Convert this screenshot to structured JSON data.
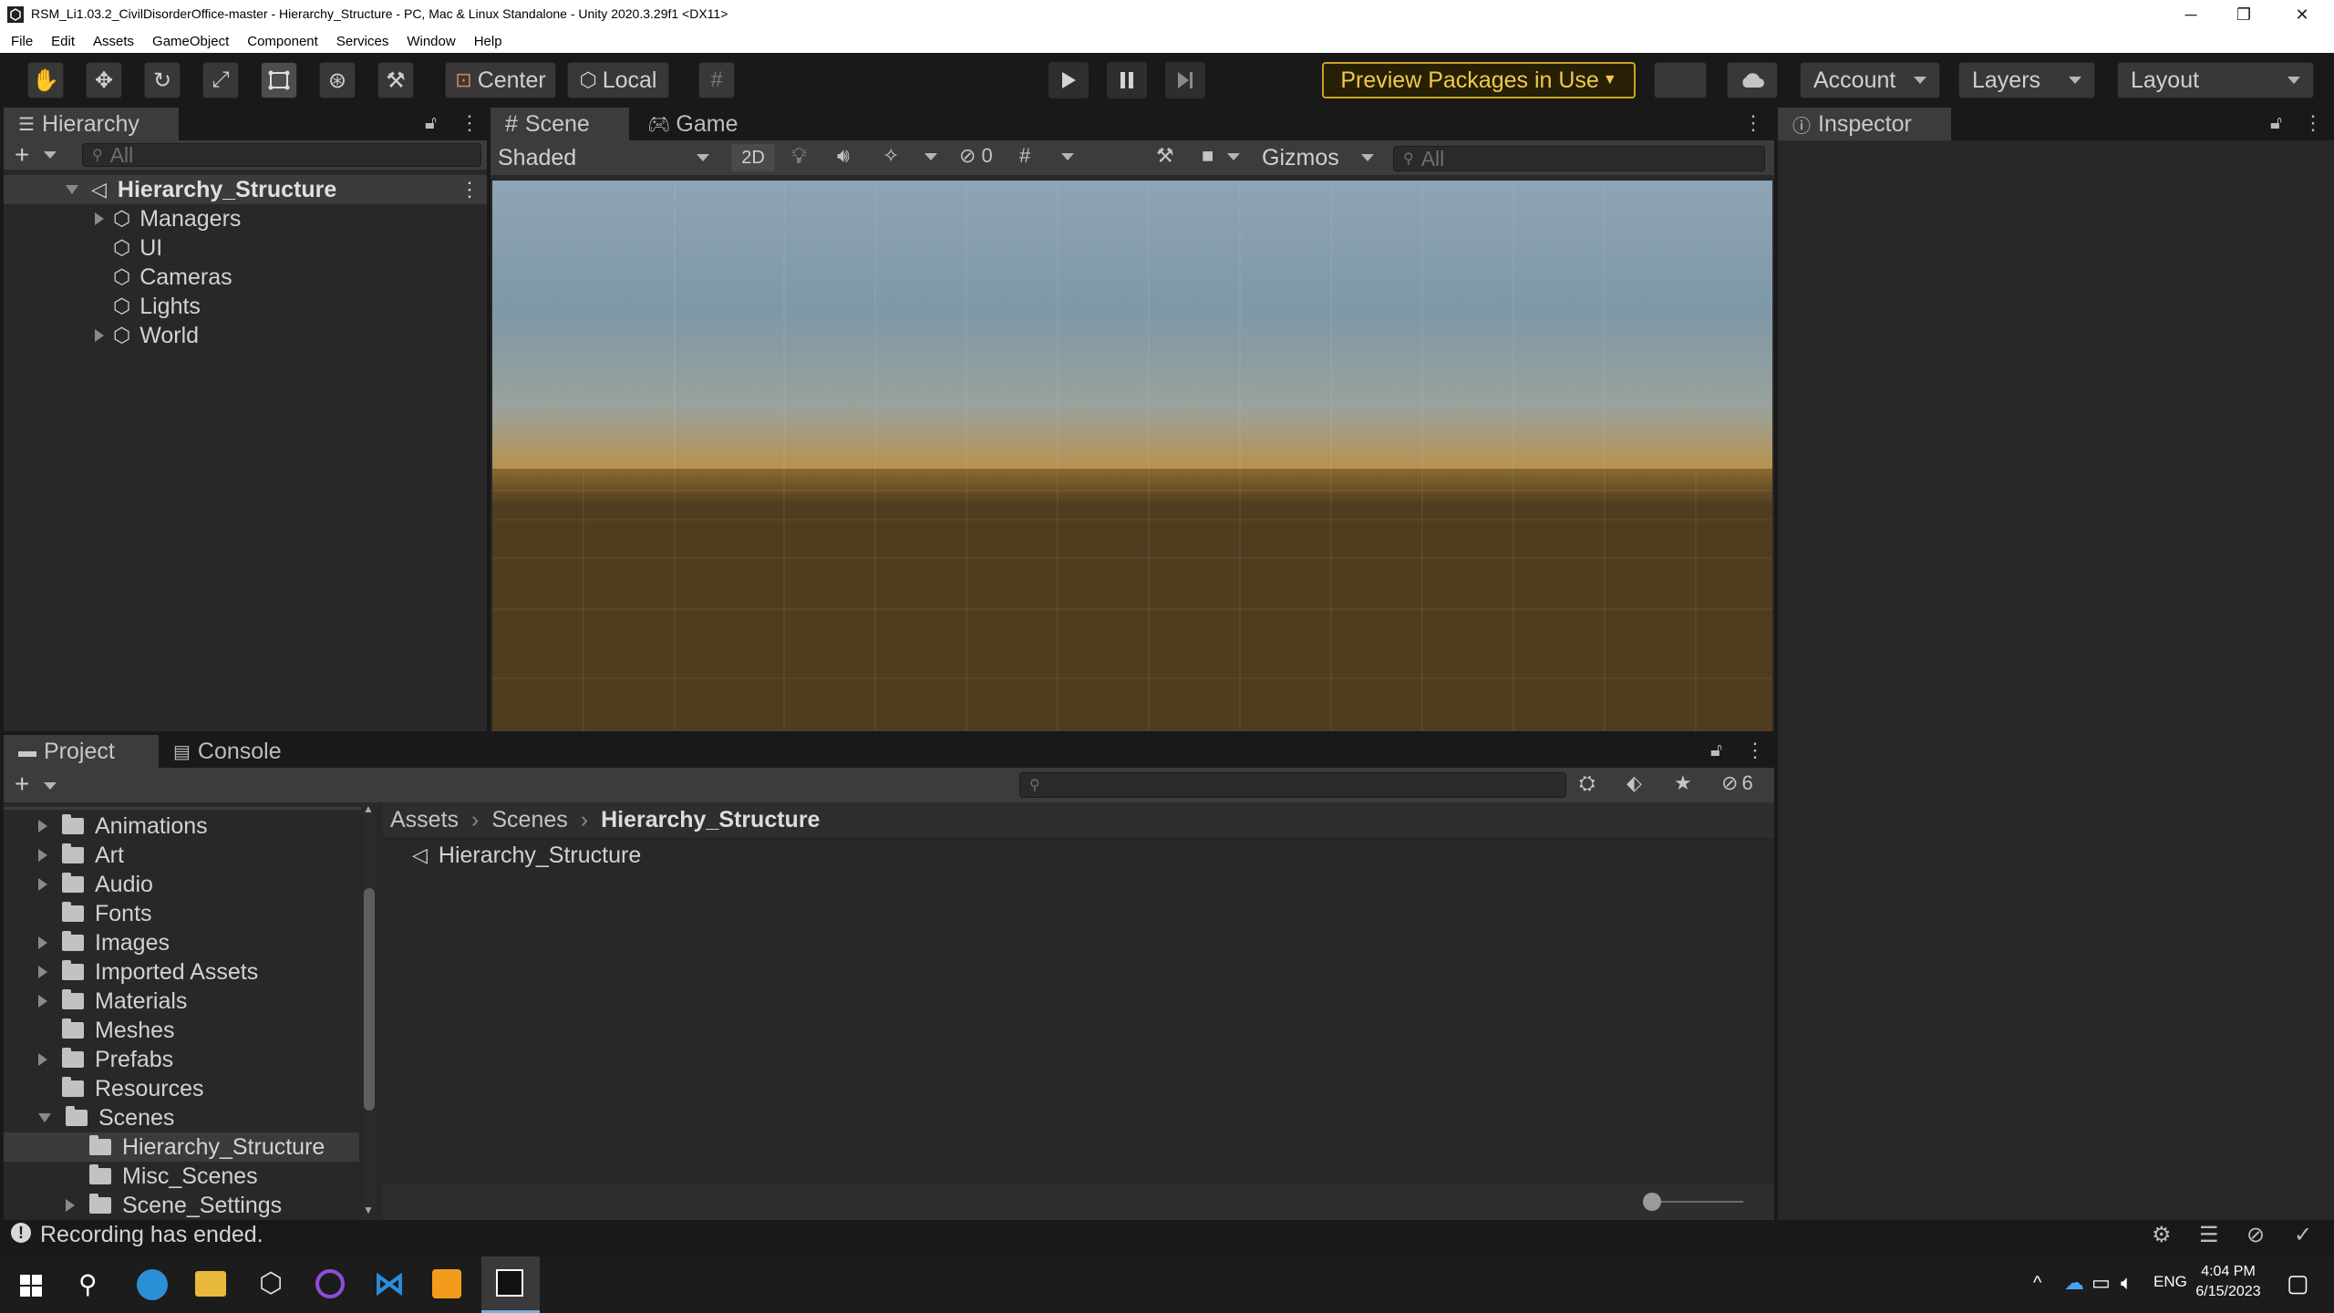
{
  "window": {
    "title": "RSM_Li1.03.2_CivilDisorderOffice-master - Hierarchy_Structure - PC, Mac & Linux Standalone - Unity 2020.3.29f1 <DX11>",
    "minimize": "─",
    "restore": "❐",
    "close": "✕"
  },
  "menu": [
    "File",
    "Edit",
    "Assets",
    "GameObject",
    "Component",
    "Services",
    "Window",
    "Help"
  ],
  "toolbar": {
    "pivot_label": "Center",
    "space_label": "Local",
    "preview_packages": "Preview Packages in Use",
    "account": "Account",
    "layers": "Layers",
    "layout": "Layout"
  },
  "hierarchy": {
    "tab": "Hierarchy",
    "search_placeholder": "All",
    "scene": "Hierarchy_Structure",
    "items": [
      {
        "label": "Managers",
        "expandable": true
      },
      {
        "label": "UI",
        "expandable": false
      },
      {
        "label": "Cameras",
        "expandable": false
      },
      {
        "label": "Lights",
        "expandable": false
      },
      {
        "label": "World",
        "expandable": true
      }
    ]
  },
  "scene_view": {
    "tab_scene": "Scene",
    "tab_game": "Game",
    "draw_mode": "Shaded",
    "mode_2d": "2D",
    "hidden_count": "0",
    "gizmos": "Gizmos",
    "search_placeholder": "All",
    "sky_top": "#8da4b4",
    "horizon": "#b8914a",
    "ground": "#4f3d1f"
  },
  "inspector": {
    "tab": "Inspector"
  },
  "project": {
    "tab_project": "Project",
    "tab_console": "Console",
    "hidden_count": "6",
    "folders": [
      {
        "label": "Animations",
        "expandable": true
      },
      {
        "label": "Art",
        "expandable": true
      },
      {
        "label": "Audio",
        "expandable": true
      },
      {
        "label": "Fonts",
        "expandable": false
      },
      {
        "label": "Images",
        "expandable": true
      },
      {
        "label": "Imported Assets",
        "expandable": true
      },
      {
        "label": "Materials",
        "expandable": true
      },
      {
        "label": "Meshes",
        "expandable": false
      },
      {
        "label": "Prefabs",
        "expandable": true
      },
      {
        "label": "Resources",
        "expandable": false
      },
      {
        "label": "Scenes",
        "expandable": true,
        "expanded": true
      }
    ],
    "subfolders": [
      {
        "label": "Hierarchy_Structure",
        "selected": true,
        "expandable": false
      },
      {
        "label": "Misc_Scenes",
        "selected": false,
        "expandable": false
      },
      {
        "label": "Scene_Settings",
        "selected": false,
        "expandable": true
      }
    ],
    "breadcrumb": [
      "Assets",
      "Scenes",
      "Hierarchy_Structure"
    ],
    "files": [
      "Hierarchy_Structure"
    ]
  },
  "status": {
    "message": "Recording has ended."
  },
  "taskbar": {
    "lang": "ENG",
    "time": "4:04 PM",
    "date": "6/15/2023"
  },
  "colors": {
    "accent_selection": "#2c5d87",
    "preview_border": "#c9a227"
  }
}
